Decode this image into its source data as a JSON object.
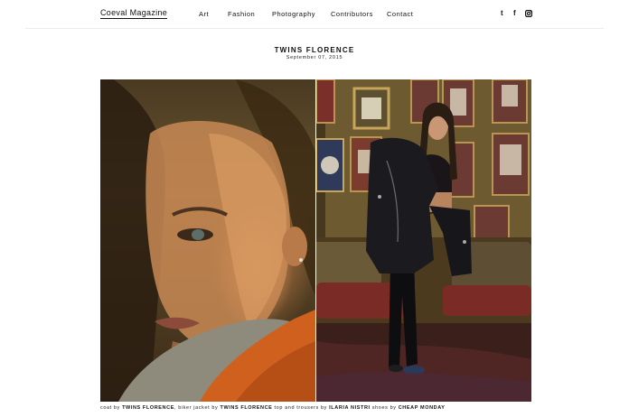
{
  "site": {
    "logo": "Coeval Magazine"
  },
  "nav": {
    "items": [
      {
        "label": "Art"
      },
      {
        "label": "Fashion"
      },
      {
        "label": "Photography"
      },
      {
        "label": "Contributors"
      },
      {
        "label": "Contact"
      }
    ]
  },
  "social": {
    "tumblr": "t",
    "facebook": "f",
    "instagram_icon": "instagram-icon"
  },
  "post": {
    "title": "TWINS FLORENCE",
    "date": "September 07, 2015"
  },
  "caption": {
    "t1": "coat by ",
    "b1": "TWINS FLORENCE",
    "t2": ", biker jacket by ",
    "b2": "TWINS FLORENCE",
    "t3": " top and trousers by ",
    "b3": "ILARIA NISTRI",
    "t4": " shoes by ",
    "b4": "CHEAP MONDAY"
  },
  "colors": {
    "background": "#ffffff",
    "text": "#111111",
    "divider": "#ececec"
  }
}
